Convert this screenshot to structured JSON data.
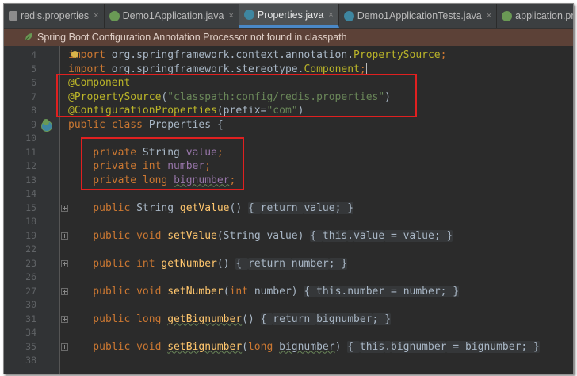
{
  "tabs": [
    {
      "label": "redis.properties",
      "icon": "properties-file-icon",
      "active": false
    },
    {
      "label": "Demo1Application.java",
      "icon": "spring-boot-class-icon",
      "active": false
    },
    {
      "label": "Properties.java",
      "icon": "java-class-icon",
      "active": true
    },
    {
      "label": "Demo1ApplicationTests.java",
      "icon": "java-class-icon",
      "active": false
    },
    {
      "label": "application.pr",
      "icon": "spring-config-icon",
      "active": false
    }
  ],
  "tab_close_glyph": "×",
  "banner": {
    "text": "Spring Boot Configuration Annotation Processor not found in classpath",
    "icon": "spring-leaf-icon"
  },
  "lines": [
    {
      "n": "4",
      "segs": [
        {
          "t": "import ",
          "c": "kw"
        },
        {
          "t": "org.springframework.context.annotation.",
          "c": "typ"
        },
        {
          "t": "PropertySource",
          "c": "ann"
        },
        {
          "t": ";",
          "c": "kw"
        }
      ]
    },
    {
      "n": "5",
      "segs": [
        {
          "t": "import ",
          "c": "kw"
        },
        {
          "t": "org.springframework.stereotype.",
          "c": "typ"
        },
        {
          "t": "Component",
          "c": "ann"
        },
        {
          "t": ";",
          "c": "kw"
        }
      ]
    },
    {
      "n": "6",
      "segs": [
        {
          "t": "@Component",
          "c": "ann"
        }
      ]
    },
    {
      "n": "7",
      "segs": [
        {
          "t": "@PropertySource",
          "c": "ann"
        },
        {
          "t": "(",
          "c": "typ"
        },
        {
          "t": "\"classpath:config/redis.properties\"",
          "c": "str"
        },
        {
          "t": ")",
          "c": "typ"
        }
      ]
    },
    {
      "n": "8",
      "segs": [
        {
          "t": "@ConfigurationProperties",
          "c": "ann"
        },
        {
          "t": "(prefix=",
          "c": "typ"
        },
        {
          "t": "\"com\"",
          "c": "str"
        },
        {
          "t": ")",
          "c": "typ"
        }
      ]
    },
    {
      "n": "9",
      "segs": [
        {
          "t": "public class ",
          "c": "kw"
        },
        {
          "t": "Properties {",
          "c": "typ"
        }
      ]
    },
    {
      "n": "10",
      "segs": []
    },
    {
      "n": "11",
      "segs": [
        {
          "t": "    private ",
          "c": "kw"
        },
        {
          "t": "String ",
          "c": "typ"
        },
        {
          "t": "value",
          "c": "fld"
        },
        {
          "t": ";",
          "c": "kw"
        }
      ]
    },
    {
      "n": "12",
      "segs": [
        {
          "t": "    private int ",
          "c": "kw"
        },
        {
          "t": "number",
          "c": "fld"
        },
        {
          "t": ";",
          "c": "kw"
        }
      ]
    },
    {
      "n": "13",
      "segs": [
        {
          "t": "    private long ",
          "c": "kw"
        },
        {
          "t": "bignumber",
          "c": "fld squig"
        },
        {
          "t": ";",
          "c": "kw"
        }
      ]
    },
    {
      "n": "14",
      "segs": []
    },
    {
      "n": "15",
      "segs": [
        {
          "t": "    public ",
          "c": "kw"
        },
        {
          "t": "String ",
          "c": "typ"
        },
        {
          "t": "getValue",
          "c": "mth"
        },
        {
          "t": "() ",
          "c": "typ"
        },
        {
          "t": "{ ",
          "c": "fold"
        },
        {
          "t": "return ",
          "c": "kw fold"
        },
        {
          "t": "value",
          "c": "fld fold"
        },
        {
          "t": "; }",
          "c": "fold"
        }
      ]
    },
    {
      "n": "18",
      "segs": []
    },
    {
      "n": "19",
      "segs": [
        {
          "t": "    public void ",
          "c": "kw"
        },
        {
          "t": "setValue",
          "c": "mth"
        },
        {
          "t": "(String value) ",
          "c": "typ"
        },
        {
          "t": "{ ",
          "c": "fold"
        },
        {
          "t": "this",
          "c": "kw fold"
        },
        {
          "t": ".",
          "c": "fold"
        },
        {
          "t": "value",
          "c": "fld fold"
        },
        {
          "t": " = value; }",
          "c": "fold"
        }
      ]
    },
    {
      "n": "22",
      "segs": []
    },
    {
      "n": "23",
      "segs": [
        {
          "t": "    public int ",
          "c": "kw"
        },
        {
          "t": "getNumber",
          "c": "mth"
        },
        {
          "t": "() ",
          "c": "typ"
        },
        {
          "t": "{ ",
          "c": "fold"
        },
        {
          "t": "return ",
          "c": "kw fold"
        },
        {
          "t": "number",
          "c": "fld fold"
        },
        {
          "t": "; }",
          "c": "fold"
        }
      ]
    },
    {
      "n": "26",
      "segs": []
    },
    {
      "n": "27",
      "segs": [
        {
          "t": "    public void ",
          "c": "kw"
        },
        {
          "t": "setNumber",
          "c": "mth"
        },
        {
          "t": "(",
          "c": "typ"
        },
        {
          "t": "int ",
          "c": "kw"
        },
        {
          "t": "number) ",
          "c": "typ"
        },
        {
          "t": "{ ",
          "c": "fold"
        },
        {
          "t": "this",
          "c": "kw fold"
        },
        {
          "t": ".",
          "c": "fold"
        },
        {
          "t": "number",
          "c": "fld fold"
        },
        {
          "t": " = number; }",
          "c": "fold"
        }
      ]
    },
    {
      "n": "30",
      "segs": []
    },
    {
      "n": "31",
      "segs": [
        {
          "t": "    public long ",
          "c": "kw"
        },
        {
          "t": "getBignumber",
          "c": "mth squig"
        },
        {
          "t": "() ",
          "c": "typ"
        },
        {
          "t": "{ ",
          "c": "fold"
        },
        {
          "t": "return ",
          "c": "kw fold"
        },
        {
          "t": "bignumber",
          "c": "fld fold"
        },
        {
          "t": "; }",
          "c": "fold"
        }
      ]
    },
    {
      "n": "34",
      "segs": []
    },
    {
      "n": "35",
      "segs": [
        {
          "t": "    public void ",
          "c": "kw"
        },
        {
          "t": "setBignumber",
          "c": "mth squig"
        },
        {
          "t": "(",
          "c": "typ"
        },
        {
          "t": "long ",
          "c": "kw"
        },
        {
          "t": "bignumber",
          "c": "typ squig"
        },
        {
          "t": ") ",
          "c": "typ"
        },
        {
          "t": "{ ",
          "c": "fold"
        },
        {
          "t": "this",
          "c": "kw fold"
        },
        {
          "t": ".",
          "c": "fold"
        },
        {
          "t": "bignumber",
          "c": "fld fold"
        },
        {
          "t": " = bignumber; }",
          "c": "fold"
        }
      ]
    },
    {
      "n": "38",
      "segs": []
    }
  ],
  "colors": {
    "background": "#2b2b2b",
    "keyword": "#cc7832",
    "annotation": "#bbb529",
    "string": "#6a8759",
    "field": "#9876aa",
    "method": "#ffc66d",
    "highlight_box": "#e02020",
    "banner": "#5c4137"
  }
}
